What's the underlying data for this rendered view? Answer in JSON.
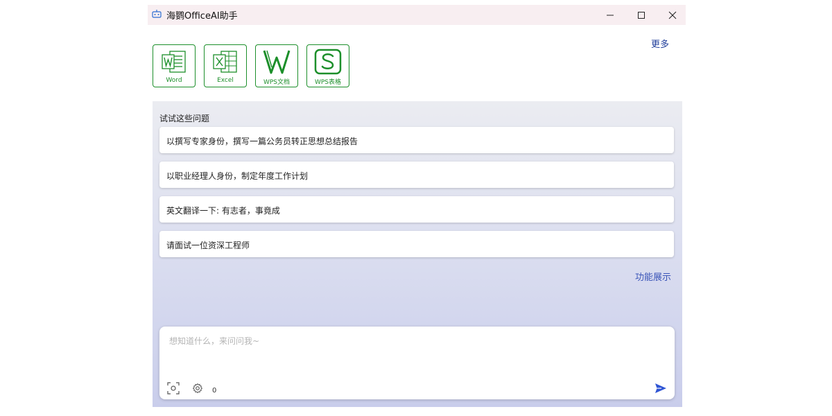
{
  "window": {
    "title": "海鹦OfficeAI助手"
  },
  "header": {
    "more_label": "更多"
  },
  "apps": [
    {
      "label": "Word",
      "icon": "word-icon"
    },
    {
      "label": "Excel",
      "icon": "excel-icon"
    },
    {
      "label": "WPS文档",
      "icon": "wps-writer-icon"
    },
    {
      "label": "WPS表格",
      "icon": "wps-spreadsheet-icon"
    }
  ],
  "suggestions": {
    "heading": "试试这些问题",
    "items": [
      "以撰写专家身份，撰写一篇公务员转正思想总结报告",
      "以职业经理人身份，制定年度工作计划",
      "英文翻译一下: 有志者，事竟成",
      "请面试一位资深工程师"
    ]
  },
  "features_link": "功能展示",
  "input": {
    "placeholder": "想知道什么，来问问我~",
    "value": "",
    "count": "0"
  },
  "colors": {
    "accent_green": "#1c8f2a",
    "link_blue": "#1f3d9a",
    "send_blue": "#2f55d4",
    "titlebar_bg": "#f8eef1"
  }
}
